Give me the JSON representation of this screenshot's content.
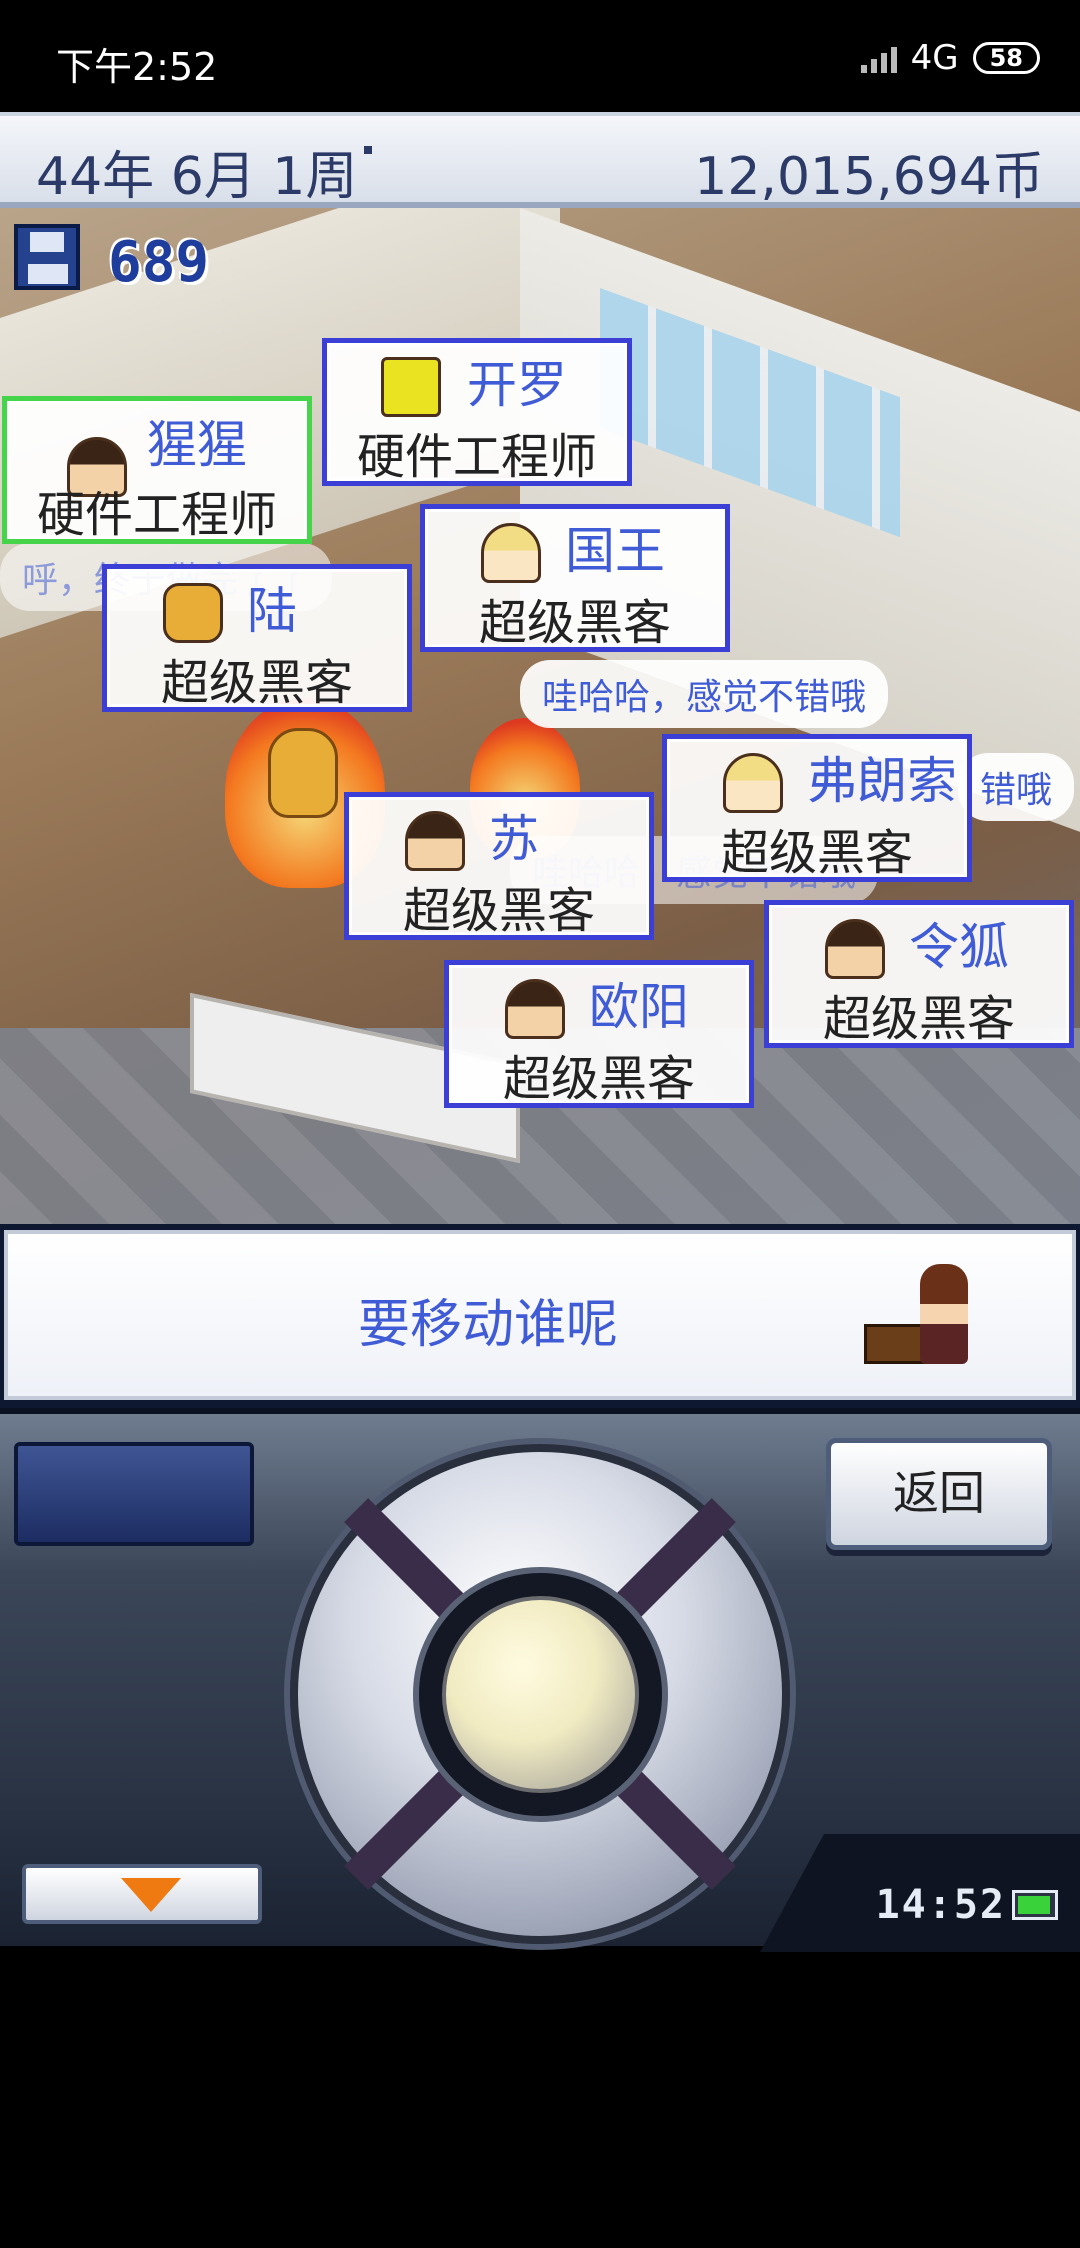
{
  "status_bar": {
    "time": "下午2:52",
    "network": "4G",
    "battery": "58"
  },
  "header": {
    "date": "44年 6月 1周",
    "money": "12,015,694币"
  },
  "world": {
    "research_points": "689",
    "speech_bubbles": [
      "哇哈哈，感觉不错哦",
      "呼，终于做完了了",
      "哇哈哈，感觉不错哦",
      "错哦"
    ],
    "employees": [
      {
        "name": "猩猩",
        "role": "硬件工程师"
      },
      {
        "name": "开罗",
        "role": "硬件工程师"
      },
      {
        "name": "国王",
        "role": "超级黑客"
      },
      {
        "name": "陆",
        "role": "超级黑客"
      },
      {
        "name": "弗朗索",
        "role": "超级黑客"
      },
      {
        "name": "苏",
        "role": "超级黑客"
      },
      {
        "name": "令狐",
        "role": "超级黑客"
      },
      {
        "name": "欧阳",
        "role": "超级黑客"
      }
    ]
  },
  "message": "要移动谁呢",
  "controller": {
    "back_label": "返回",
    "clock": "14:52"
  }
}
